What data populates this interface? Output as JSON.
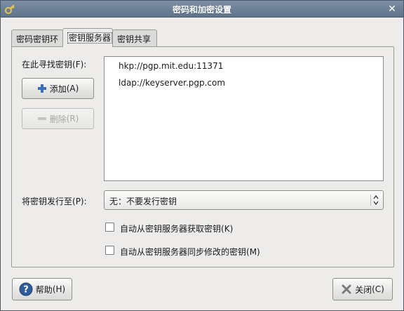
{
  "window": {
    "title": "密码和加密设置",
    "close_glyph": "✕"
  },
  "tabs": [
    {
      "label": "密码密钥环"
    },
    {
      "label": "密钥服务器"
    },
    {
      "label": "密钥共享"
    }
  ],
  "servers": {
    "find_label": "在此寻找密钥",
    "find_mnemonic": "(F)",
    "find_colon": ":",
    "add_label": "添加",
    "add_mnemonic": "(A)",
    "remove_label": "删除",
    "remove_mnemonic": "(R)",
    "items": [
      "hkp://pgp.mit.edu:11371",
      "ldap://keyserver.pgp.com"
    ]
  },
  "publish": {
    "label": "将密钥发行至",
    "mnemonic": "(P)",
    "colon": ":",
    "selected": "无：不要发行密钥"
  },
  "options": {
    "auto_retrieve_label": "自动从密钥服务器获取密钥",
    "auto_retrieve_mnemonic": "(K)",
    "auto_retrieve_checked": false,
    "auto_sync_label": "自动从密钥服务器同步修改的密钥",
    "auto_sync_mnemonic": "(M)",
    "auto_sync_checked": false
  },
  "footer": {
    "help_label": "帮助",
    "help_mnemonic": "(H)",
    "close_label": "关闭",
    "close_mnemonic": "(C)"
  },
  "colors": {
    "titlebar": "#6a7e95",
    "add_icon": "#3a6fb7",
    "help_icon": "#2f5d9a",
    "close_icon": "#7a7a7a"
  }
}
